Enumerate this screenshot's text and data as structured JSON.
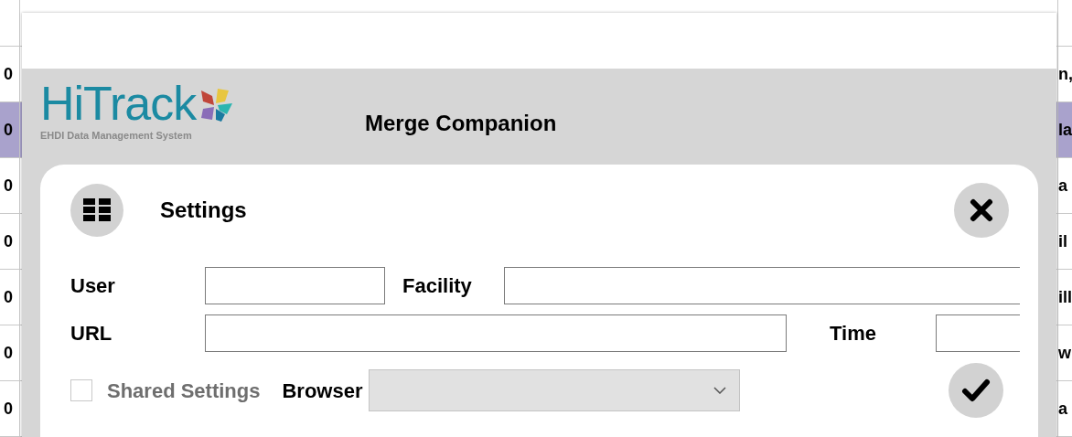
{
  "background_table": {
    "rows": [
      {
        "column_1": "",
        "column_2": "",
        "selected": false
      },
      {
        "column_1": "0",
        "column_2": "n,",
        "selected": false
      },
      {
        "column_1": "0",
        "column_2": "la",
        "selected": true
      },
      {
        "column_1": "0",
        "column_2": "a",
        "selected": false
      },
      {
        "column_1": "0",
        "column_2": "il",
        "selected": false
      },
      {
        "column_1": "0",
        "column_2": "ill",
        "selected": false
      },
      {
        "column_1": "0",
        "column_2": "w",
        "selected": false
      },
      {
        "column_1": "0",
        "column_2": "a",
        "selected": false
      }
    ]
  },
  "dialog": {
    "logo": {
      "name": "HiTrack",
      "tagline": "EHDI Data Management System"
    },
    "title": "Merge Companion",
    "panel": {
      "title": "Settings",
      "user": {
        "label": "User"
      },
      "facility": {
        "label": "Facility"
      },
      "url": {
        "label": "URL"
      },
      "time": {
        "label": "Time"
      },
      "shared_settings": {
        "label": "Shared Settings",
        "checked": false,
        "disabled": true
      },
      "browser": {
        "label": "Browser",
        "disabled": true
      }
    }
  }
}
